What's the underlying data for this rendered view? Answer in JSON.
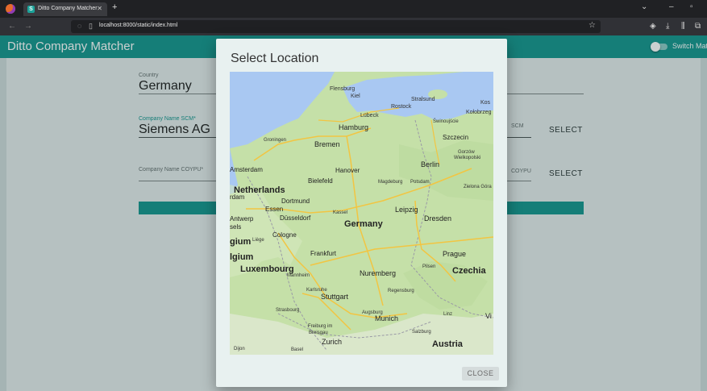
{
  "browser": {
    "tab_title": "Ditto Company Matcher",
    "tab_favicon_letter": "S",
    "url": "localhost:8000/static/index.html"
  },
  "app": {
    "title": "Ditto Company Matcher",
    "switch_label": "Switch Match"
  },
  "form": {
    "country_label": "Country",
    "country_value": "Germany",
    "scm_label": "Company Name SCM*",
    "scm_value": "Siemens AG",
    "scm_right_label": "SCM",
    "coypu_label": "Company Name COYPU*",
    "coypu_right_label": "COYPU",
    "select_label": "SELECT"
  },
  "dialog": {
    "title": "Select Location",
    "close_label": "CLOSE"
  },
  "map": {
    "cities": [
      "Flensburg",
      "Kiel",
      "Stralsund",
      "Rostock",
      "Lübeck",
      "Koszalin",
      "Kołobrzeg",
      "Hamburg",
      "Świnoujście",
      "Szczecin",
      "Groningen",
      "Bremen",
      "Gorzów Wielkopolski",
      "Amsterdam",
      "Hanover",
      "Berlin",
      "Bielefeld",
      "Magdeburg",
      "Potsdam",
      "Zielona Góra",
      "Netherlands",
      "Dortmund",
      "Essen",
      "Leipzig",
      "Antwerp",
      "Düsseldorf",
      "Kassel",
      "Dresden",
      "Cologne",
      "Germany",
      "Liège",
      "Belgium",
      "Frankfurt",
      "Prague",
      "Pilsen",
      "Luxembourg",
      "Mannheim",
      "Nuremberg",
      "Czechia",
      "Karlsruhe",
      "Stuttgart",
      "Regensburg",
      "Strasbourg",
      "Augsburg",
      "Munich",
      "Linz",
      "Freiburg im Breisgau",
      "Salzburg",
      "Zurich",
      "Basel",
      "Austria",
      "Dijon",
      "Vi"
    ]
  },
  "colors": {
    "appbar": "#17968f",
    "page_bg": "#e5ecec",
    "water": "#a9c8f2",
    "land": "#c5e0a8"
  }
}
